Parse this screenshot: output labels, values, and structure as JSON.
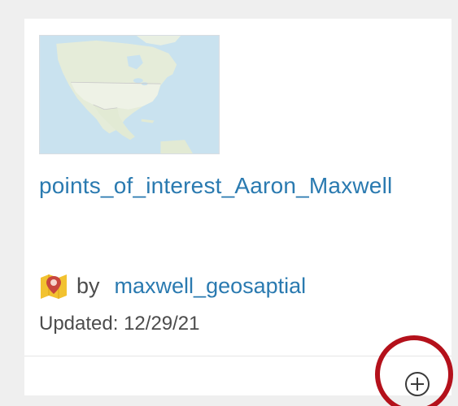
{
  "card": {
    "title": "points_of_interest_Aaron_Maxwell",
    "by_label": "by",
    "owner": "maxwell_geosaptial",
    "updated": "Updated: 12/29/21"
  },
  "thumbnail": {
    "alt": "map thumbnail of North America"
  },
  "icons": {
    "item_type": "map-layer-icon",
    "add": "plus-circle-icon"
  },
  "colors": {
    "link": "#2a7ab0",
    "text": "#4c4c4c",
    "highlight": "#b4111b"
  }
}
